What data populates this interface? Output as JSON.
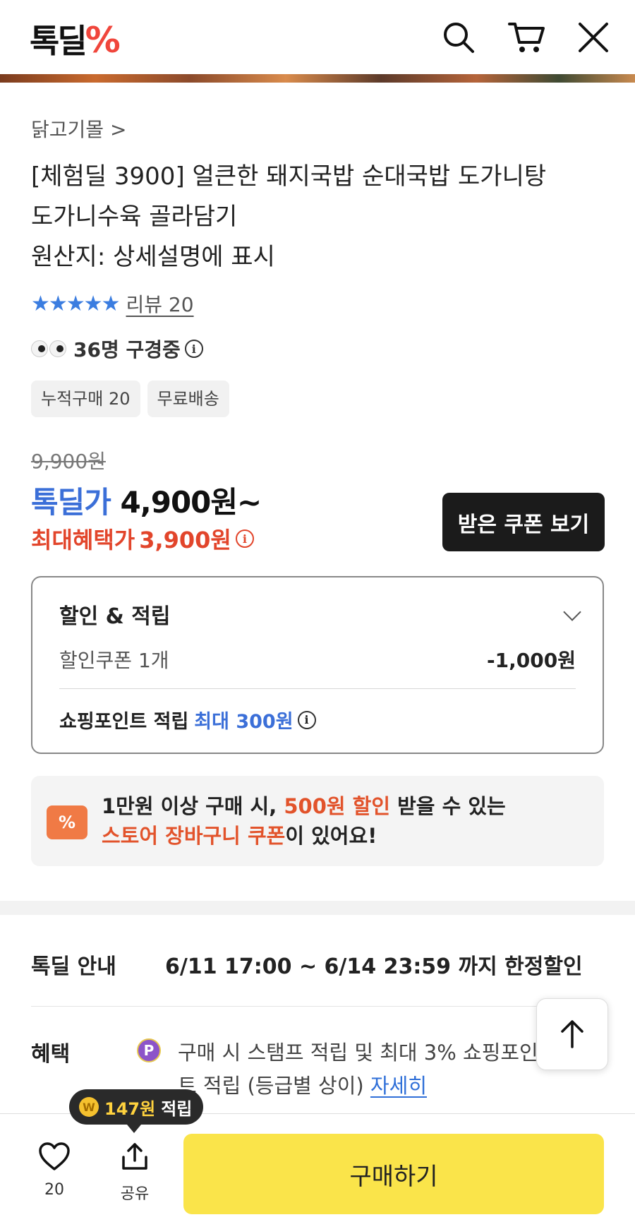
{
  "header": {
    "logo_text": "톡딜",
    "logo_mark": "%",
    "icons": [
      "search-icon",
      "cart-icon",
      "close-icon"
    ]
  },
  "product": {
    "store": "닭고기몰 >",
    "title_line1": "[체험딜 3900] 얼큰한 돼지국밥 순대국밥 도가니탕",
    "title_line2": "도가니수육 골라담기",
    "title_line3": "원산지: 상세설명에 표시",
    "stars": "★★★★★",
    "review_label": "리뷰 20",
    "viewers": "36명 구경중",
    "tags": [
      "누적구매 20",
      "무료배송"
    ]
  },
  "price": {
    "original": "9,900원",
    "deal_label": "톡딜가",
    "deal_price": "4,900원~",
    "best_label": "최대혜택가",
    "best_price": "3,900원",
    "coupon_button": "받은 쿠폰 보기"
  },
  "discount": {
    "title": "할인 & 적립",
    "coupon_label": "할인쿠폰 1개",
    "coupon_value": "-1,000원",
    "point_label": "쇼핑포인트 적립",
    "point_value": "최대 300원"
  },
  "promo": {
    "icon_glyph": "%",
    "line1_a": "1만원 이상 구매 시, ",
    "line1_b": "500원 할인",
    "line1_c": " 받을 수 있는",
    "line2_a": "스토어 장바구니 쿠폰",
    "line2_b": "이 있어요!"
  },
  "deal_info": {
    "label": "톡딜 안내",
    "value": "6/11 17:00 ~ 6/14 23:59 까지 한정할인"
  },
  "benefit": {
    "label": "혜택",
    "badge": "P",
    "text": "구매 시 스탬프 적립 및 최대 3% 쇼핑포인트 적립 (등급별 상이) ",
    "link": "자세히"
  },
  "bottom": {
    "tooltip_amount": "147원",
    "tooltip_label": "적립",
    "like_count": "20",
    "share_label": "공유",
    "buy_label": "구매하기"
  },
  "colors": {
    "accent_blue": "#3b6fd8",
    "accent_red": "#e2452b",
    "buy_yellow": "#fae44a"
  }
}
